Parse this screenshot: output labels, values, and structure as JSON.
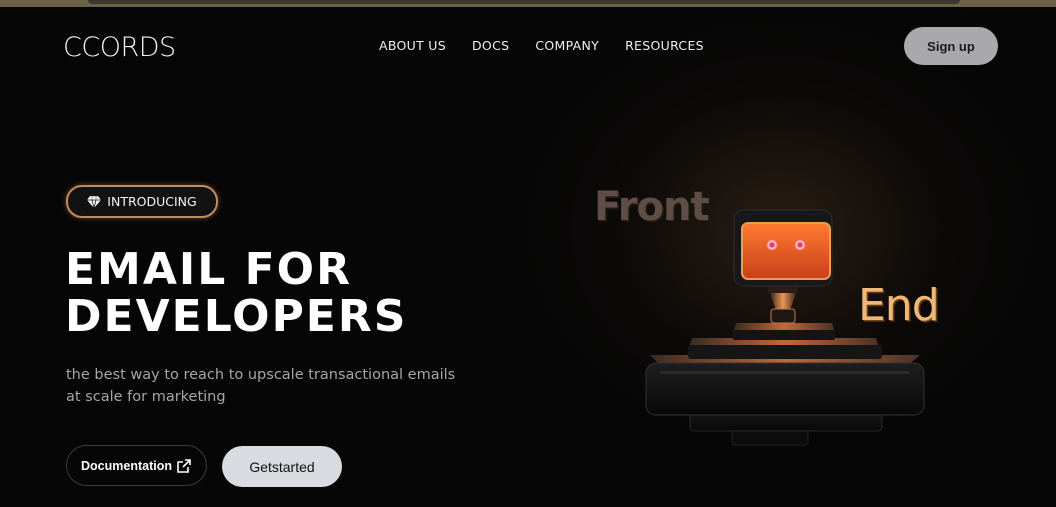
{
  "top_bar": {
    "logo": "CCORDS",
    "nav": [
      "ABOUT US",
      "DOCS",
      "COMPANY",
      "RESOURCES"
    ],
    "signup_label": "Sign up"
  },
  "hero": {
    "badge_icon": "diamond-icon",
    "badge_label": "INTRODUCING",
    "headline_line1": "EMAIL FOR",
    "headline_line2": "DEVELOPERS",
    "subtitle": "the best way to reach to upscale transactional emails at scale for marketing",
    "doc_button_label": "Documentation",
    "doc_button_icon": "external-link-icon",
    "start_button_label": "Getstarted"
  },
  "illustration": {
    "word_front": "Front",
    "word_end": "End"
  },
  "colors": {
    "background": "#060606",
    "badge_border": "#c28a5d",
    "accent_orange": "#e85d1c",
    "end_text": "#f0b878",
    "signup_bg": "#a9a9ab",
    "start_bg": "#d9dbe0"
  }
}
